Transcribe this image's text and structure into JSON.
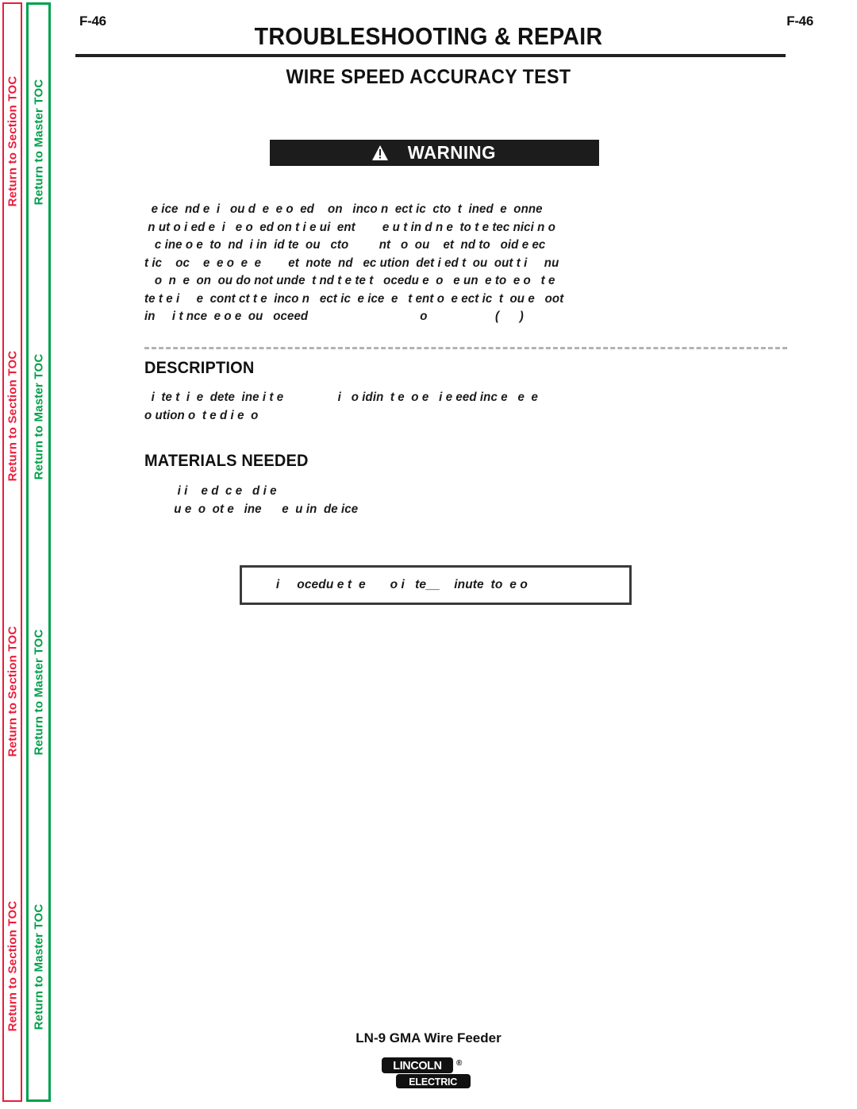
{
  "sidebar": {
    "section_toc_label": "Return to Section TOC",
    "master_toc_label": "Return to Master TOC",
    "section_toc_color": "#ed1c3a",
    "master_toc_color": "#00a14b",
    "repeat_count": 4
  },
  "header": {
    "page_number_left": "F-46",
    "page_number_right": "F-46",
    "section_title": "TROUBLESHOOTING & REPAIR",
    "document_title": "WIRE SPEED ACCURACY TEST"
  },
  "warning": {
    "bar_label": "WARNING",
    "icon": "warning-triangle-icon",
    "background_color": "#1c1c1c",
    "paragraph_1": "  e ice  nd e  i   ou d  e  e o  ed    on   inco n  ect ic  cto  t  ined  e  onne\n n ut o i ed e  i   e o  ed on t i e ui  ent        e u t in d n e  to t e tec nici n o\n   c ine o e  to  nd  i in  id te  ou   cto         nt   o  ou    et  nd to   oid e ec\nt ic    oc    e  e o  e  e        et  note  nd   ec ution  det i ed t  ou  out t i     nu",
    "paragraph_2": "   o  n  e  on  ou do not unde  t nd t e te t   ocedu e  o   e un  e to  e o   t e\nte t e i     e  cont ct t e  inco n   ect ic  e ice  e   t ent o  e ect ic  t  ou e   oot\nin     i t nce  e o e  ou   oceed                                 o                    (      )"
  },
  "description": {
    "heading": "DESCRIPTION",
    "body": "  i  te t  i  e  dete  ine i t e                i   o idin  t e  o e   i e eed inc e   e  e\no ution o  t e d i e  o"
  },
  "materials": {
    "heading": "MATERIALS NEEDED",
    "body": "  i i    e d  c e   d i e\n u e  o  ot e   ine      e  u in  de ice"
  },
  "note_box": {
    "text": "  i     ocedu e t  e       o i   te__    inute  to  e o"
  },
  "footer": {
    "product_name": "LN-9 GMA Wire Feeder",
    "logo_primary": "LINCOLN",
    "logo_secondary": "ELECTRIC",
    "logo_registered": "®"
  }
}
